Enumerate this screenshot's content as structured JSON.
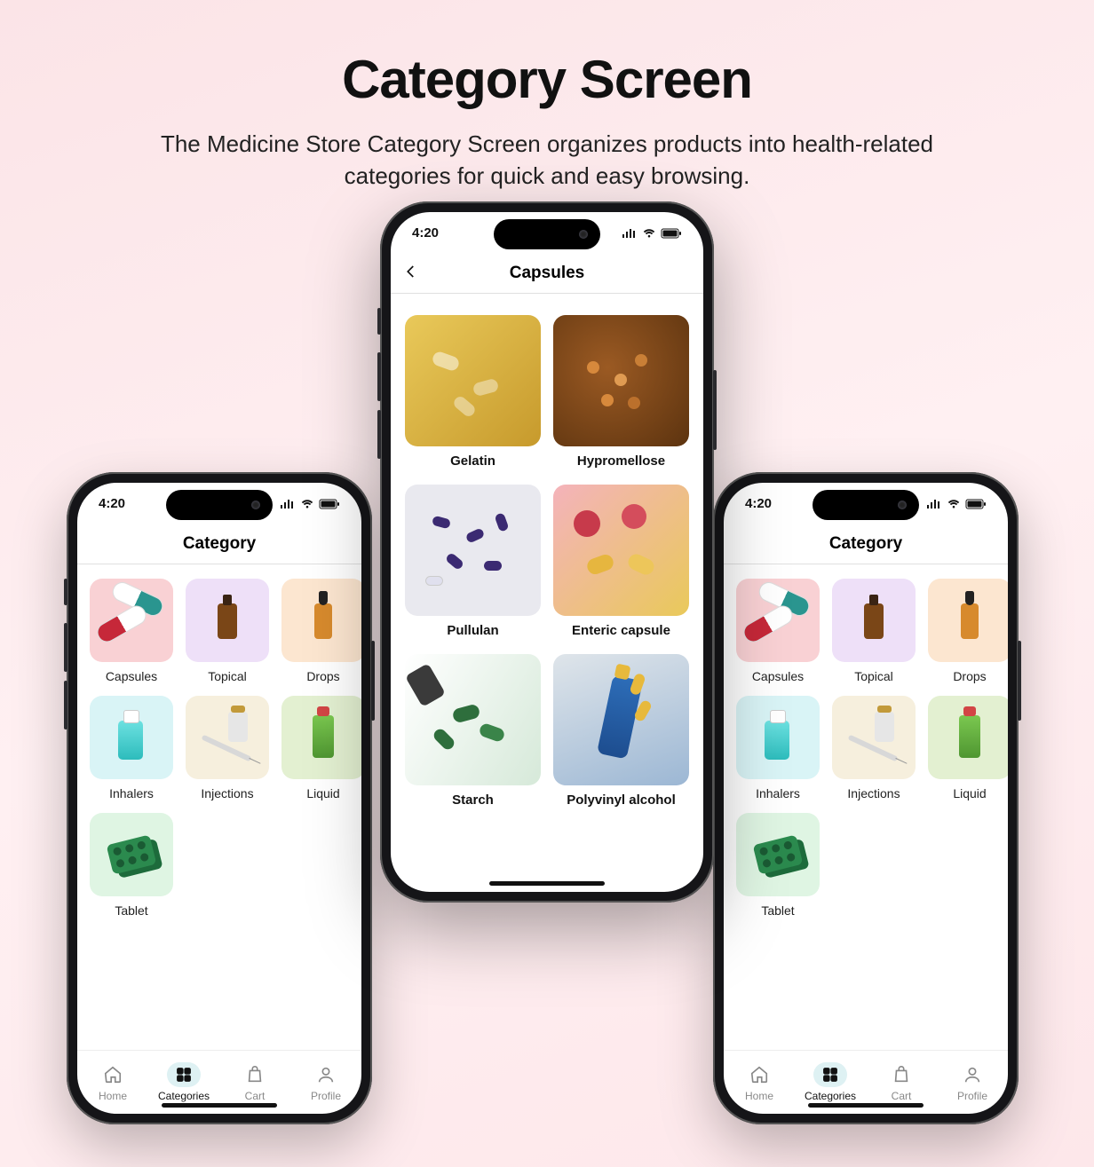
{
  "hero": {
    "title": "Category Screen",
    "subtitle": "The Medicine Store Category Screen organizes products into health-related categories for quick and easy browsing."
  },
  "status": {
    "time": "4:20"
  },
  "screens": {
    "category": {
      "title": "Category"
    },
    "capsules": {
      "title": "Capsules"
    }
  },
  "categories": [
    {
      "label": "Capsules",
      "bg": "bg-pink"
    },
    {
      "label": "Topical",
      "bg": "bg-purple"
    },
    {
      "label": "Drops",
      "bg": "bg-orange"
    },
    {
      "label": "Inhalers",
      "bg": "bg-cyan"
    },
    {
      "label": "Injections",
      "bg": "bg-cream"
    },
    {
      "label": "Liquid",
      "bg": "bg-lgreen"
    },
    {
      "label": "Tablet",
      "bg": "bg-mint"
    }
  ],
  "subcategories": [
    {
      "label": "Gelatin",
      "img": "img-gelatin"
    },
    {
      "label": "Hypromellose",
      "img": "img-hypro"
    },
    {
      "label": "Pullulan",
      "img": "img-pullulan"
    },
    {
      "label": "Enteric capsule",
      "img": "img-enteric"
    },
    {
      "label": "Starch",
      "img": "img-starch"
    },
    {
      "label": "Polyvinyl alcohol",
      "img": "img-poly"
    }
  ],
  "nav": {
    "home": "Home",
    "categories": "Categories",
    "cart": "Cart",
    "profile": "Profile"
  }
}
